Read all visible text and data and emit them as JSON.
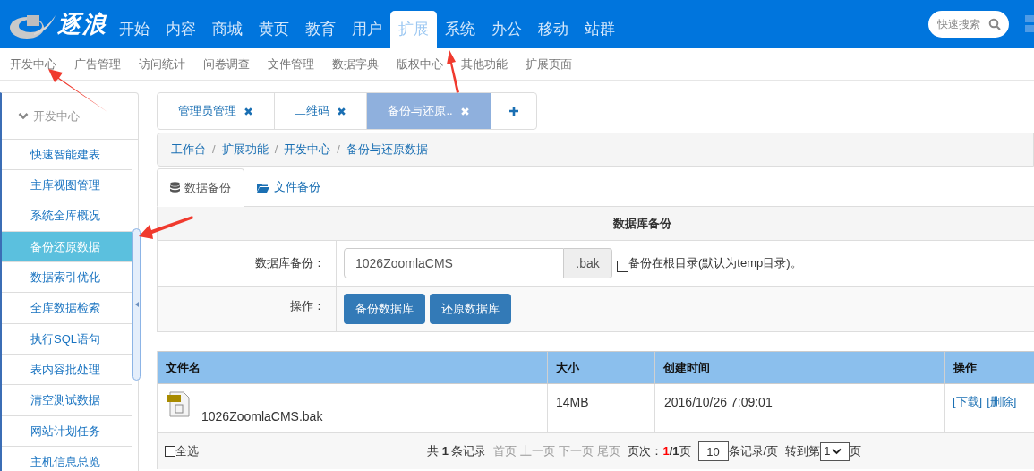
{
  "logo": {
    "text": "逐浪"
  },
  "main_nav": [
    {
      "label": "开始",
      "selected": false
    },
    {
      "label": "内容",
      "selected": false
    },
    {
      "label": "商城",
      "selected": false
    },
    {
      "label": "黄页",
      "selected": false
    },
    {
      "label": "教育",
      "selected": false
    },
    {
      "label": "用户",
      "selected": false
    },
    {
      "label": "扩展",
      "selected": true
    },
    {
      "label": "系统",
      "selected": false
    },
    {
      "label": "办公",
      "selected": false
    },
    {
      "label": "移动",
      "selected": false
    },
    {
      "label": "站群",
      "selected": false
    }
  ],
  "search": {
    "placeholder": "快速搜索"
  },
  "sub_nav": [
    "开发中心",
    "广告管理",
    "访问统计",
    "问卷调查",
    "文件管理",
    "数据字典",
    "版权中心",
    "其他功能",
    "扩展页面"
  ],
  "sidebar": {
    "title": "开发中心",
    "items": [
      {
        "label": "快速智能建表",
        "selected": false
      },
      {
        "label": "主库视图管理",
        "selected": false
      },
      {
        "label": "系统全库概况",
        "selected": false
      },
      {
        "label": "备份还原数据",
        "selected": true
      },
      {
        "label": "数据索引优化",
        "selected": false
      },
      {
        "label": "全库数据检索",
        "selected": false
      },
      {
        "label": "执行SQL语句",
        "selected": false
      },
      {
        "label": "表内容批处理",
        "selected": false
      },
      {
        "label": "清空测试数据",
        "selected": false
      },
      {
        "label": "网站计划任务",
        "selected": false
      },
      {
        "label": "主机信息总览",
        "selected": false
      }
    ]
  },
  "page_tabs": [
    {
      "label": "管理员管理",
      "selected": false
    },
    {
      "label": "二维码",
      "selected": false
    },
    {
      "label": "备份与还原..",
      "selected": true
    }
  ],
  "breadcrumb": {
    "separator": "/",
    "items": [
      "工作台",
      "扩展功能",
      "开发中心",
      "备份与还原数据"
    ]
  },
  "content_tabs": [
    {
      "label": "数据备份",
      "kind": "database",
      "selected": true
    },
    {
      "label": "文件备份",
      "kind": "folder",
      "selected": false
    }
  ],
  "form": {
    "title": "数据库备份",
    "backup_label": "数据库备份：",
    "file_name": "1026ZoomlaCMS",
    "suffix": ".bak",
    "root_option": {
      "label": "备份在根目录(默认为temp目录)。",
      "checked": false
    },
    "actions_label": "操作：",
    "buttons": [
      "备份数据库",
      "还原数据库"
    ]
  },
  "table": {
    "columns": [
      "文件名",
      "大小",
      "创建时间",
      "操作"
    ],
    "rows": [
      {
        "file": "1026ZoomlaCMS.bak",
        "size": "14MB",
        "created": "2016/10/26 7:09:01",
        "actions": [
          "[下载]",
          "[删除]"
        ]
      }
    ],
    "footer": {
      "select_all": {
        "label": "全选",
        "checked": false
      },
      "total_prefix": "共",
      "total": "1",
      "total_suffix": "条记录",
      "page_links": [
        "首页",
        "上一页",
        "下一页",
        "尾页"
      ],
      "page_label": "页次：",
      "current_page": "1",
      "total_pages": "/1",
      "page_unit": "页",
      "page_size": "10",
      "page_size_suffix": "条记录/页",
      "goto_label": "转到第",
      "goto_value": "1",
      "goto_suffix": "页"
    }
  }
}
